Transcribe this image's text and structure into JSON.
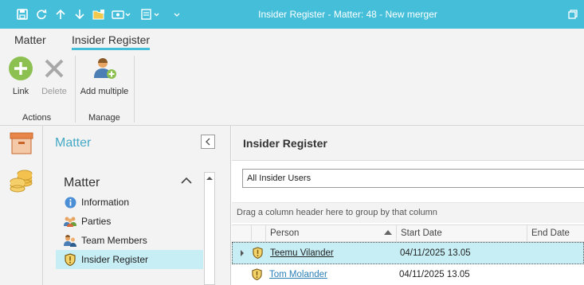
{
  "window": {
    "title": "Insider Register - Matter: 48 - New merger",
    "quick_access_icons": [
      "save-icon",
      "refresh-icon",
      "arrow-up-icon",
      "arrow-down-icon",
      "new-folder-icon",
      "view-icon",
      "form-icon",
      "customize-icon"
    ]
  },
  "ribbon": {
    "tabs": [
      {
        "label": "Matter",
        "active": false
      },
      {
        "label": "Insider Register",
        "active": true
      }
    ],
    "groups": [
      {
        "label": "Actions",
        "buttons": [
          {
            "label": "Link",
            "icon": "add-circle-icon",
            "enabled": true
          },
          {
            "label": "Delete",
            "icon": "delete-x-icon",
            "enabled": false
          }
        ]
      },
      {
        "label": "Manage",
        "buttons": [
          {
            "label": "Add multiple",
            "icon": "add-person-icon",
            "enabled": true
          }
        ]
      }
    ]
  },
  "rail": {
    "items": [
      "matter-box-icon",
      "coins-icon"
    ]
  },
  "nav": {
    "header": "Matter",
    "section": "Matter",
    "items": [
      {
        "label": "Information",
        "icon": "info-icon",
        "selected": false
      },
      {
        "label": "Parties",
        "icon": "parties-icon",
        "selected": false
      },
      {
        "label": "Team Members",
        "icon": "team-members-icon",
        "selected": false
      },
      {
        "label": "Insider Register",
        "icon": "insider-shield-icon",
        "selected": true
      }
    ]
  },
  "main": {
    "title": "Insider Register",
    "filter": "All Insider Users",
    "group_hint": "Drag a column header here to group by that column",
    "columns": [
      "Person",
      "Start Date",
      "End Date"
    ],
    "rows": [
      {
        "person": "Teemu Vilander",
        "start": "04/11/2025 13.05",
        "end": ""
      },
      {
        "person": "Tom Molander",
        "start": "04/11/2025 13.05",
        "end": ""
      }
    ]
  },
  "colors": {
    "accent": "#45bfd9",
    "selection": "#c7eef5",
    "link": "#2a7fb6"
  }
}
